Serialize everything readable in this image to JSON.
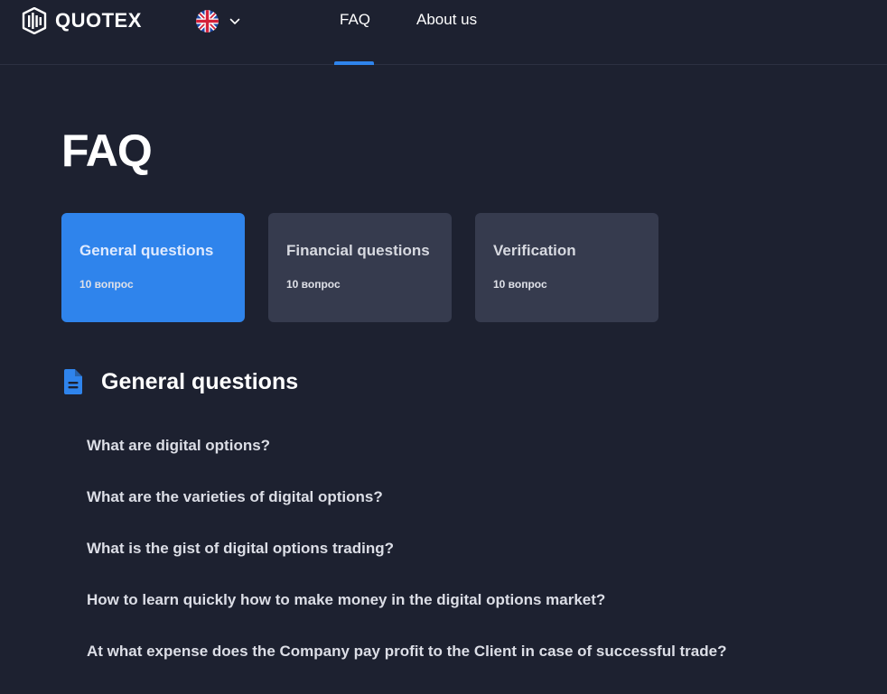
{
  "header": {
    "brand": "QUOTEX",
    "icons": {
      "logo": "quotex-logo-icon",
      "language": "uk-flag-icon",
      "dropdown": "chevron-down-icon"
    },
    "nav": [
      {
        "label": "FAQ",
        "active": true
      },
      {
        "label": "About us",
        "active": false
      }
    ]
  },
  "main": {
    "title": "FAQ",
    "categories": [
      {
        "title": "General questions",
        "count": "10 вопрос",
        "active": true
      },
      {
        "title": "Financial questions",
        "count": "10 вопрос",
        "active": false
      },
      {
        "title": "Verification",
        "count": "10 вопрос",
        "active": false
      }
    ],
    "section": {
      "icon": "document-icon",
      "title": "General questions",
      "questions": [
        "What are digital options?",
        "What are the varieties of digital options?",
        "What is the gist of digital options trading?",
        "How to learn quickly how to make money in the digital options market?",
        "At what expense does the Company pay profit to the Client in case of successful trade?"
      ]
    }
  },
  "colors": {
    "background": "#1d2130",
    "accent": "#2f84ec",
    "card": "#363b4e"
  }
}
